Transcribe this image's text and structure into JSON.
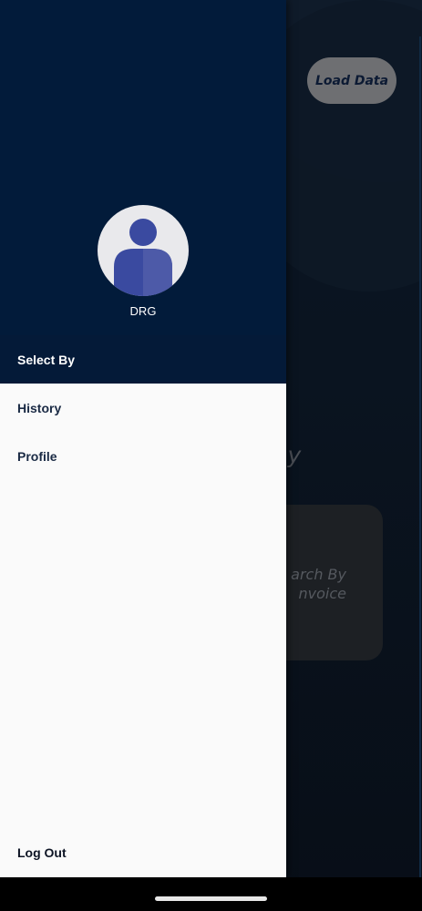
{
  "background": {
    "load_button_label": "Load Data",
    "query_title": "ery By",
    "search_card_text_line1": "arch By",
    "search_card_text_line2": "nvoice"
  },
  "drawer": {
    "username": "DRG",
    "section_header": "Select By",
    "items": [
      {
        "label": "History",
        "icon": "none"
      },
      {
        "label": "Profile",
        "icon": "none"
      }
    ],
    "logout_label": "Log Out"
  },
  "colors": {
    "drawer_header": "#021b3a",
    "drawer_body": "#fafafa",
    "avatar_figure": "#3a4aa0"
  }
}
